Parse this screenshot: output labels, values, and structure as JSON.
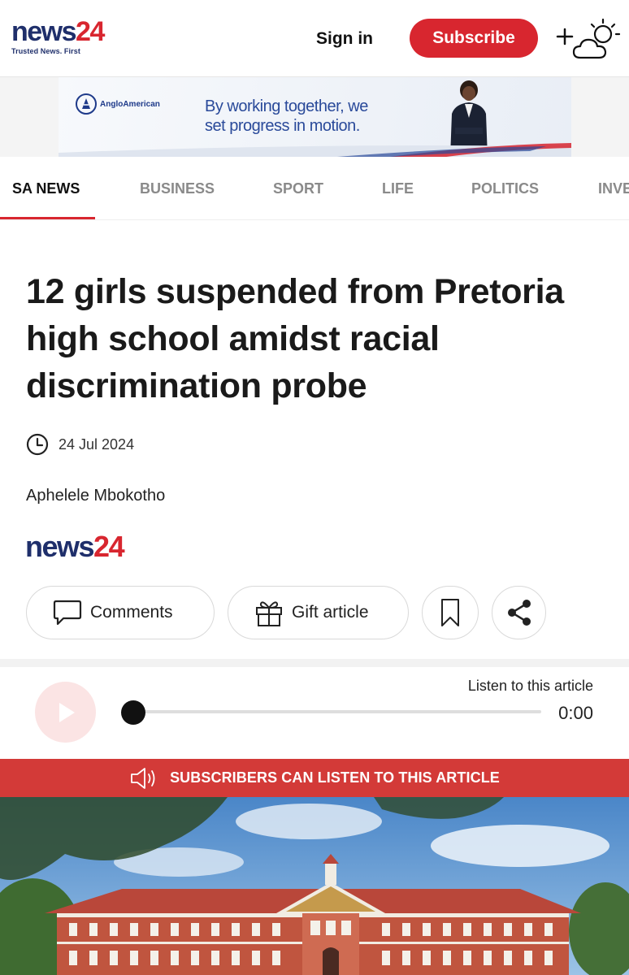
{
  "header": {
    "logo_main": "news",
    "logo_num": "24",
    "tagline": "Trusted News. First",
    "sign_in": "Sign in",
    "subscribe": "Subscribe",
    "weather_icon": "add-weather-icon"
  },
  "ad": {
    "brand": "AngloAmerican",
    "line1": "By working together, we",
    "line2": "set progress in motion."
  },
  "nav": {
    "items": [
      "SA NEWS",
      "BUSINESS",
      "SPORT",
      "LIFE",
      "POLITICS",
      "INVE"
    ],
    "active": "SA NEWS"
  },
  "article": {
    "headline": "12 girls suspended from Pretoria high school amidst racial discrimination probe",
    "date": "24 Jul 2024",
    "author": "Aphelele Mbokotho",
    "source_main": "news",
    "source_num": "24"
  },
  "actions": {
    "comments": "Comments",
    "gift": "Gift article"
  },
  "player": {
    "listen_label": "Listen to this article",
    "time": "0:00",
    "progress": 0
  },
  "banner": {
    "text": "SUBSCRIBERS CAN LISTEN TO THIS ARTICLE"
  },
  "colors": {
    "brand_red": "#d8262f",
    "brand_navy": "#1f2f6b",
    "banner_red": "#d33a38"
  }
}
